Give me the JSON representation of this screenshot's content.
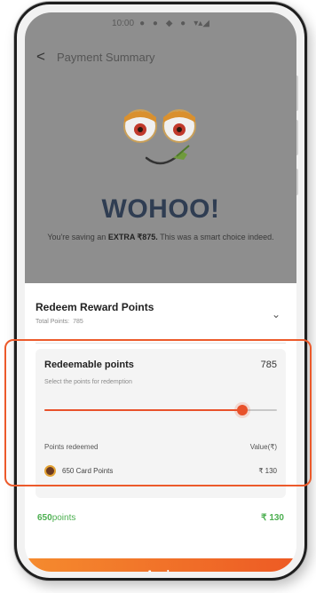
{
  "status_bar": {
    "left": "10:00",
    "indicators": "● ● ◆ ●",
    "right": "▾▴◢"
  },
  "header": {
    "back_label": "<",
    "title": "Payment Summary"
  },
  "celebration": {
    "headline": "WOHOO!",
    "message_prefix": "You're saving an",
    "message_bold": "EXTRA ₹875.",
    "message_suffix": "This was a smart choice indeed."
  },
  "redeem_section": {
    "title": "Redeem Reward Points",
    "total_points_label": "Total Points:",
    "total_points_value": "785"
  },
  "redeemable": {
    "label": "Redeemable points",
    "value": "785",
    "hint": "Select the points for redemption",
    "slider_fraction": 0.85
  },
  "redeemed": {
    "label": "Points redeemed",
    "value_label": "Value(₹)",
    "card_points": "650 Card Points",
    "card_value": "₹ 130"
  },
  "summary": {
    "points_number": "650",
    "points_unit": "points",
    "value": "₹ 130"
  },
  "apply_button": {
    "label": "Apply"
  },
  "colors": {
    "accent": "#e8512a",
    "green": "#4caf50",
    "headline": "#2f3d52"
  }
}
